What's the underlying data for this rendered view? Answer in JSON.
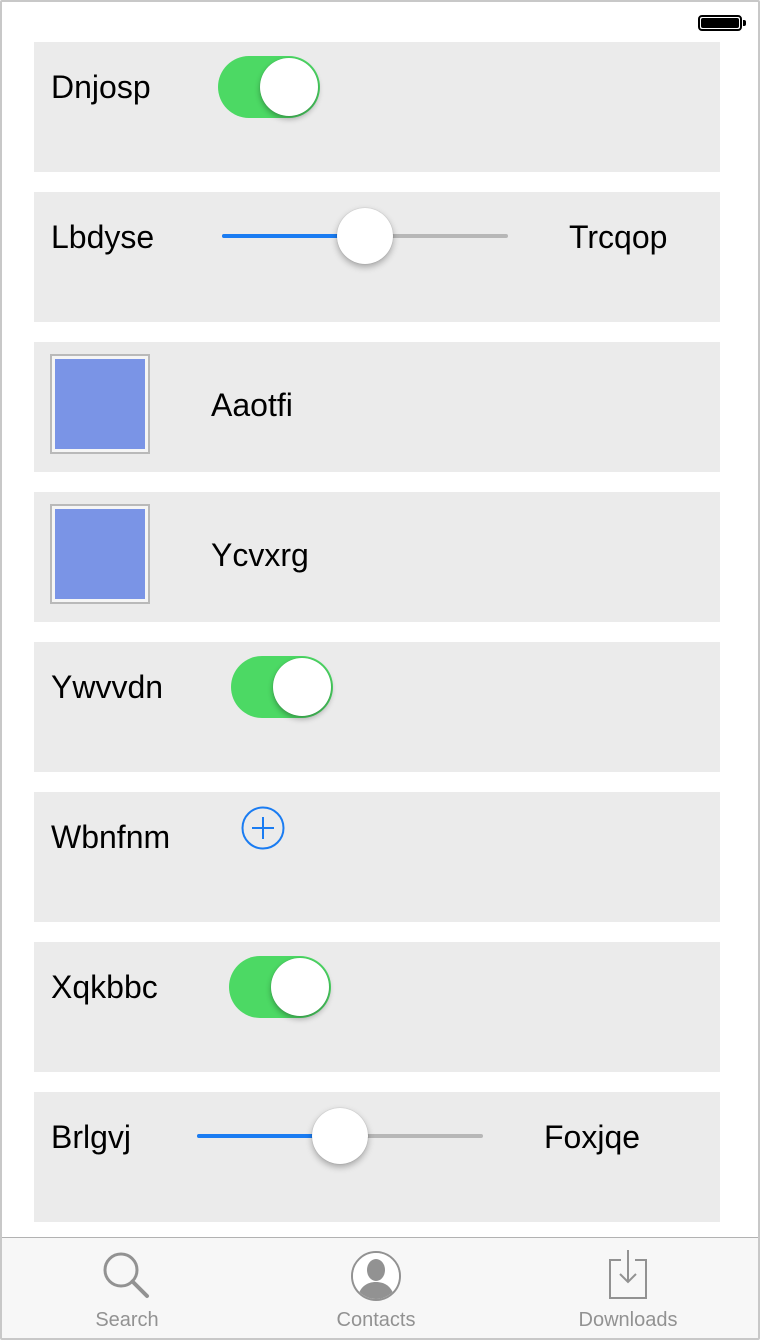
{
  "status_bar": {
    "battery_icon": "battery-full-icon"
  },
  "rows": [
    {
      "type": "toggle",
      "label": "Dnjosp",
      "on": true
    },
    {
      "type": "slider",
      "left_label": "Lbdyse",
      "right_label": "Trcqop",
      "value_fraction": 0.5
    },
    {
      "type": "image",
      "label": "Aaotfi"
    },
    {
      "type": "image",
      "label": "Ycvxrg"
    },
    {
      "type": "toggle",
      "label": "Ywvvdn",
      "on": true
    },
    {
      "type": "add",
      "label": "Wbnfnm",
      "icon": "plus-circle-icon"
    },
    {
      "type": "toggle",
      "label": "Xqkbbc",
      "on": true
    },
    {
      "type": "slider",
      "left_label": "Brlgvj",
      "right_label": "Foxjqe",
      "value_fraction": 0.5
    }
  ],
  "tab_bar": {
    "tabs": [
      {
        "label": "Search",
        "icon": "search-icon"
      },
      {
        "label": "Contacts",
        "icon": "contact-icon"
      },
      {
        "label": "Downloads",
        "icon": "download-icon"
      }
    ]
  },
  "colors": {
    "toggle_on": "#4cd964",
    "slider_fill": "#1a7cf2",
    "slider_track": "#b7b7b7",
    "row_background": "#ebebeb",
    "image_swatch": "#7a94e6",
    "tab_label": "#929292"
  }
}
